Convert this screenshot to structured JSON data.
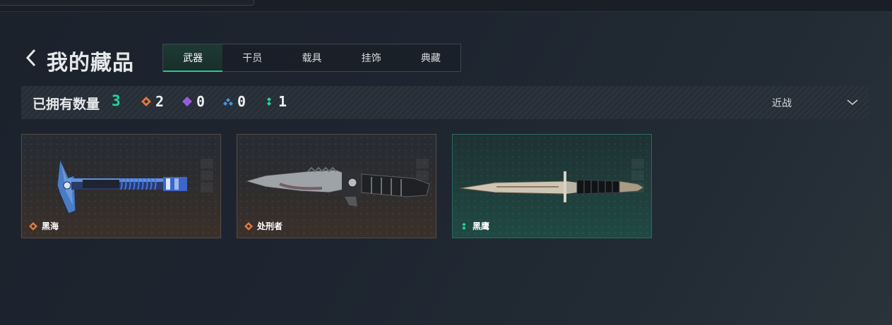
{
  "page": {
    "title": "我的藏品"
  },
  "tabs": [
    {
      "label": "武器",
      "active": true
    },
    {
      "label": "干员",
      "active": false
    },
    {
      "label": "载具",
      "active": false
    },
    {
      "label": "挂饰",
      "active": false
    },
    {
      "label": "典藏",
      "active": false
    }
  ],
  "stats": {
    "owned_label": "已拥有数量",
    "owned_count": "3",
    "rarities": [
      {
        "icon": "orange-rarity-icon",
        "color": "#e07a3c",
        "count": "2"
      },
      {
        "icon": "purple-rarity-icon",
        "color": "#9a5fe0",
        "count": "0"
      },
      {
        "icon": "blue-rarity-icon",
        "color": "#4a93e0",
        "count": "0"
      },
      {
        "icon": "green-rarity-icon",
        "color": "#21d59a",
        "count": "1"
      }
    ],
    "filter_label": "近战"
  },
  "items": [
    {
      "name": "黑海",
      "rarity": "orange",
      "weapon_icon": "axe-icon"
    },
    {
      "name": "处刑者",
      "rarity": "orange",
      "weapon_icon": "combat-knife-icon"
    },
    {
      "name": "黑鹰",
      "rarity": "green",
      "weapon_icon": "dagger-icon"
    }
  ],
  "colors": {
    "accent": "#19d08d",
    "orange": "#e07a3c",
    "green": "#21d59a"
  }
}
